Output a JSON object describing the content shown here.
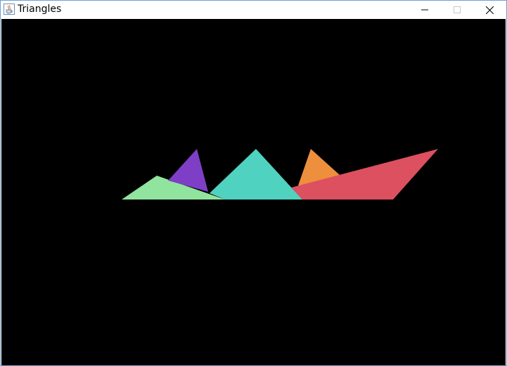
{
  "window": {
    "title": "Triangles",
    "icon": "java-cup-icon",
    "controls": {
      "minimize_icon": "minimize-icon",
      "maximize_icon": "maximize-icon",
      "close_icon": "close-icon"
    }
  },
  "canvas": {
    "background": "#000000",
    "shapes": [
      {
        "name": "triangle-light-green",
        "color": "#90e49e"
      },
      {
        "name": "triangle-purple",
        "color": "#7e3fc6"
      },
      {
        "name": "triangle-turquoise",
        "color": "#4fd3c0"
      },
      {
        "name": "triangle-orange",
        "color": "#ee8f3d"
      },
      {
        "name": "triangle-red",
        "color": "#dc5060"
      }
    ]
  }
}
